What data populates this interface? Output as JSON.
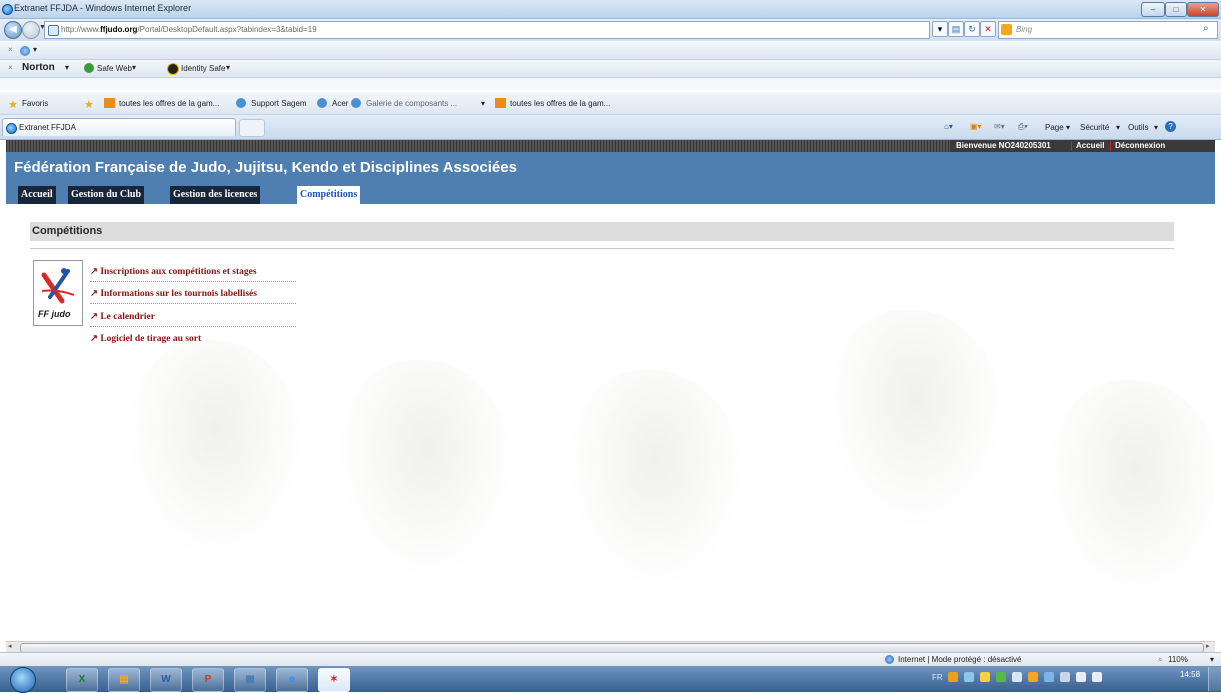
{
  "window": {
    "title": "Extranet FFJDA - Windows Internet Explorer"
  },
  "addressbar": {
    "url_prefix": "http://www.",
    "url_domain": "ffjudo.org",
    "url_rest": "/Portal/DesktopDefault.aspx?tabindex=3&tabid=19"
  },
  "search": {
    "placeholder": "Bing"
  },
  "norton": {
    "brand": "Norton",
    "safeweb": "Safe Web",
    "identity": "Identity Safe"
  },
  "favbar": {
    "favoris": "Favoris",
    "items": [
      "toutes les offres de la gam...",
      "Support Sagem",
      "Acer",
      "Galerie de composants ...",
      "toutes les offres de la gam..."
    ]
  },
  "tab": {
    "label": "Extranet FFJDA"
  },
  "cmdbar": {
    "page": "Page",
    "securite": "Sécurité",
    "outils": "Outils"
  },
  "site": {
    "welcome": "Bienvenue NO240205301",
    "accueil_link": "Accueil",
    "logout": "Déconnexion",
    "title": "Fédération Française de Judo, Jujitsu, Kendo et Disciplines Associées",
    "nav": [
      "Accueil",
      "Gestion du Club",
      "Gestion des licences",
      "Compétitions"
    ],
    "section_title": "Compétitions",
    "logo_text": "FF judo",
    "links": [
      "Inscriptions aux compétitions et stages",
      "Informations sur les tournois labellisés",
      "Le calendrier",
      "Logiciel de tirage au sort"
    ]
  },
  "statusbar": {
    "zone": "Internet | Mode protégé : désactivé",
    "zoom": "110%"
  },
  "taskbar": {
    "lang": "FR",
    "time": "14:58"
  }
}
